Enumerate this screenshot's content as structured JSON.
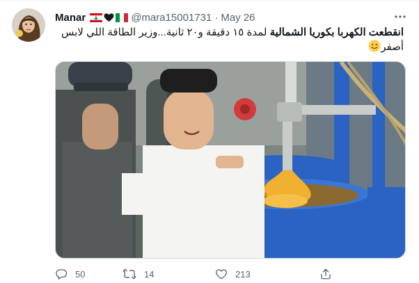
{
  "author": {
    "name": "Manar",
    "handle": "@mara15001731",
    "separator": "·",
    "date": "May 26",
    "flag_icons": [
      "lebanon-flag-icon",
      "black-heart-icon",
      "italy-flag-icon"
    ]
  },
  "tweet": {
    "text_bold": "انقطعت الكهربا بكوريا الشمالية",
    "text_rest": " لمدة ١٥ دقيقة و٢٠ ثانية...وزير الطاقة اللي لابس أصفر",
    "emoji": "slightly-smiling-face-icon"
  },
  "actions": {
    "reply_count": "50",
    "retweet_count": "14",
    "like_count": "213"
  },
  "colors": {
    "text": "#0f1419",
    "secondary": "#536471",
    "border": "#cfd9de",
    "flag_red": "#ce1126",
    "flag_green": "#009246",
    "barrel_blue": "#2a63c2",
    "honey": "#f0b030"
  }
}
